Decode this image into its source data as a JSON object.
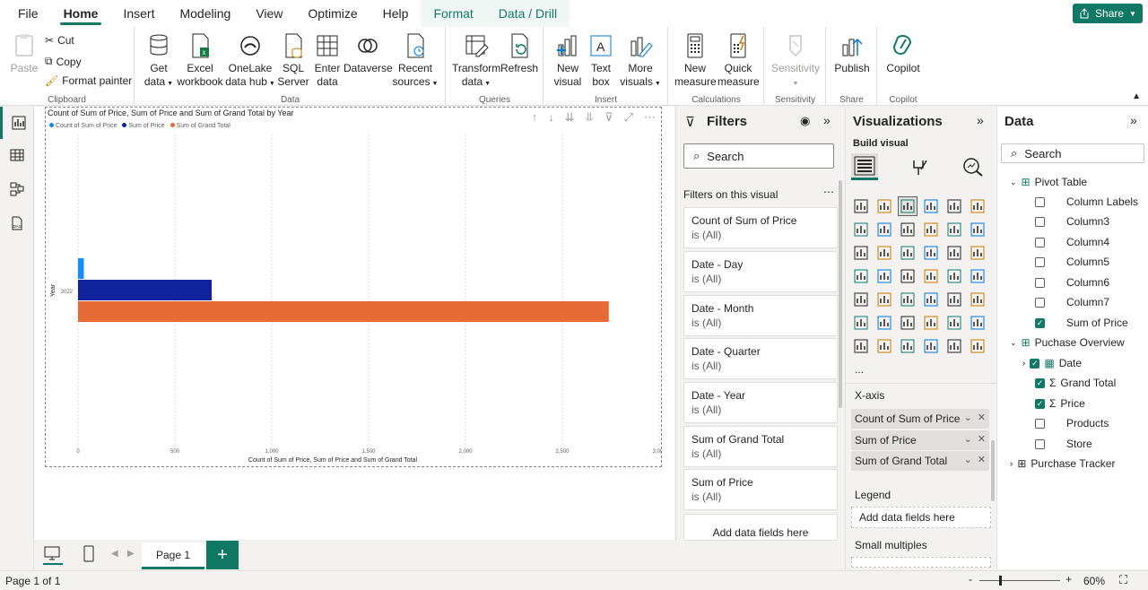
{
  "menu": {
    "items": [
      {
        "label": "File",
        "active": false
      },
      {
        "label": "Home",
        "active": true
      },
      {
        "label": "Insert",
        "active": false
      },
      {
        "label": "Modeling",
        "active": false
      },
      {
        "label": "View",
        "active": false
      },
      {
        "label": "Optimize",
        "active": false
      },
      {
        "label": "Help",
        "active": false
      },
      {
        "label": "Format",
        "context": true
      },
      {
        "label": "Data / Drill",
        "context": true
      }
    ],
    "share_label": "Share"
  },
  "ribbon": {
    "clipboard": {
      "paste": "Paste",
      "cut": "Cut",
      "copy": "Copy",
      "format_painter": "Format painter",
      "label": "Clipboard"
    },
    "data": {
      "get_data_1": "Get",
      "get_data_2": "data",
      "excel_1": "Excel",
      "excel_2": "workbook",
      "onelake_1": "OneLake",
      "onelake_2": "data hub",
      "sql_1": "SQL",
      "sql_2": "Server",
      "enter_1": "Enter",
      "enter_2": "data",
      "dataverse": "Dataverse",
      "recent_1": "Recent",
      "recent_2": "sources",
      "label": "Data"
    },
    "queries": {
      "transform_1": "Transform",
      "transform_2": "data",
      "refresh": "Refresh",
      "label": "Queries"
    },
    "insert": {
      "new_visual_1": "New",
      "new_visual_2": "visual",
      "text_box_1": "Text",
      "text_box_2": "box",
      "more_visuals_1": "More",
      "more_visuals_2": "visuals",
      "label": "Insert"
    },
    "calculations": {
      "new_measure_1": "New",
      "new_measure_2": "measure",
      "quick_measure_1": "Quick",
      "quick_measure_2": "measure",
      "label": "Calculations"
    },
    "sensitivity": {
      "sensitivity": "Sensitivity",
      "label": "Sensitivity"
    },
    "share": {
      "publish": "Publish",
      "label": "Share"
    },
    "copilot": {
      "copilot": "Copilot",
      "label": "Copilot"
    }
  },
  "visual": {
    "title": "Count of Sum of Price, Sum of Price and Sum of Grand Total by Year"
  },
  "chart_data": {
    "type": "bar",
    "orientation": "horizontal",
    "title": "Count of Sum of Price, Sum of Price and Sum of Grand Total by Year",
    "categories": [
      "2022"
    ],
    "series": [
      {
        "name": "Count of Sum of Price",
        "values": [
          30
        ],
        "color": "#118DFF"
      },
      {
        "name": "Sum of Price",
        "values": [
          690
        ],
        "color": "#12239E"
      },
      {
        "name": "Sum of Grand Total",
        "values": [
          2740
        ],
        "color": "#E66C37"
      }
    ],
    "xlabel": "Count of Sum of Price, Sum of Price and Sum of Grand Total",
    "ylabel": "Year",
    "xlim": [
      0,
      3000
    ],
    "xticks": [
      "0",
      "500",
      "1,000",
      "1,500",
      "2,000",
      "2,500",
      "3,000"
    ],
    "grid": true,
    "legend": "top-left"
  },
  "pages": {
    "current": "Page 1"
  },
  "status": {
    "page_indicator": "Page 1 of 1",
    "zoom": "60%"
  },
  "filters": {
    "title": "Filters",
    "search_placeholder": "Search",
    "section": "Filters on this visual",
    "cards": [
      {
        "name": "Count of Sum of Price",
        "state": "is (All)"
      },
      {
        "name": "Date - Day",
        "state": "is (All)"
      },
      {
        "name": "Date - Month",
        "state": "is (All)"
      },
      {
        "name": "Date - Quarter",
        "state": "is (All)"
      },
      {
        "name": "Date - Year",
        "state": "is (All)"
      },
      {
        "name": "Sum of Grand Total",
        "state": "is (All)"
      },
      {
        "name": "Sum of Price",
        "state": "is (All)"
      }
    ],
    "add_fields": "Add data fields here"
  },
  "visualizations": {
    "title": "Visualizations",
    "build_visual": "Build visual",
    "x_axis": "X-axis",
    "x_fields": [
      "Count of Sum of Price",
      "Sum of Price",
      "Sum of Grand Total"
    ],
    "legend_label": "Legend",
    "legend_drop": "Add data fields here",
    "small_multiples": "Small multiples",
    "more": "..."
  },
  "data": {
    "title": "Data",
    "search_placeholder": "Search",
    "tables": [
      {
        "name": "Pivot Table",
        "fields": [
          {
            "name": "Column Labels",
            "checked": false
          },
          {
            "name": "Column3",
            "checked": false
          },
          {
            "name": "Column4",
            "checked": false
          },
          {
            "name": "Column5",
            "checked": false
          },
          {
            "name": "Column6",
            "checked": false
          },
          {
            "name": "Column7",
            "checked": false
          },
          {
            "name": "Sum of Price",
            "checked": true
          }
        ]
      },
      {
        "name": "Puchase Overview",
        "fields": [
          {
            "name": "Date",
            "checked": true
          },
          {
            "name": "Grand Total",
            "checked": true
          },
          {
            "name": "Price",
            "checked": true
          },
          {
            "name": "Products",
            "checked": false
          },
          {
            "name": "Store",
            "checked": false
          }
        ]
      },
      {
        "name": "Purchase Tracker",
        "fields": []
      }
    ]
  }
}
